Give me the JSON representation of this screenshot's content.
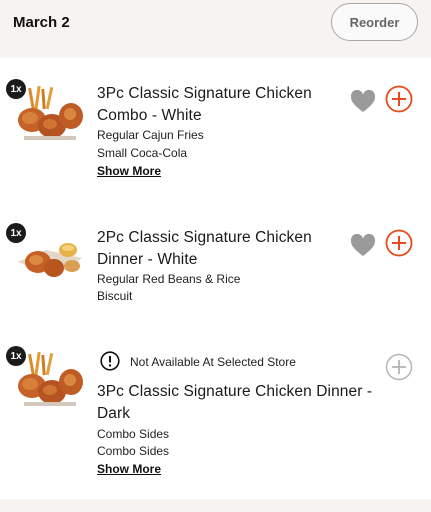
{
  "header": {
    "date": "March 2",
    "reorder_label": "Reorder"
  },
  "items": [
    {
      "qty": "1x",
      "title_line1": "3Pc Classic Signature Chicken",
      "title_line2": "Combo - White",
      "details": [
        "Regular Cajun Fries",
        "Small Coca-Cola"
      ],
      "show_more": "Show More",
      "favorite_icon": "heart-icon",
      "add_icon": "plus-circle-icon",
      "add_color": "#e8491b"
    },
    {
      "qty": "1x",
      "title_line1": "2Pc Classic Signature Chicken",
      "title_line2": "Dinner - White",
      "details": [
        "Regular Red Beans & Rice",
        "Biscuit"
      ],
      "favorite_icon": "heart-icon",
      "add_icon": "plus-circle-icon",
      "add_color": "#e8491b"
    },
    {
      "qty": "1x",
      "notice": "Not Available At Selected Store",
      "title_line1": "3Pc Classic Signature Chicken Dinner -",
      "title_line2": "Dark",
      "details": [
        "Combo Sides",
        "Combo Sides"
      ],
      "show_more": "Show More",
      "warning_icon": "exclamation-circle-icon",
      "add_icon": "plus-circle-icon",
      "add_color": "#b5b5b5"
    }
  ],
  "colors": {
    "header_bg": "#f6f3f1",
    "accent": "#e8491b",
    "heart": "#9a9a9a"
  }
}
